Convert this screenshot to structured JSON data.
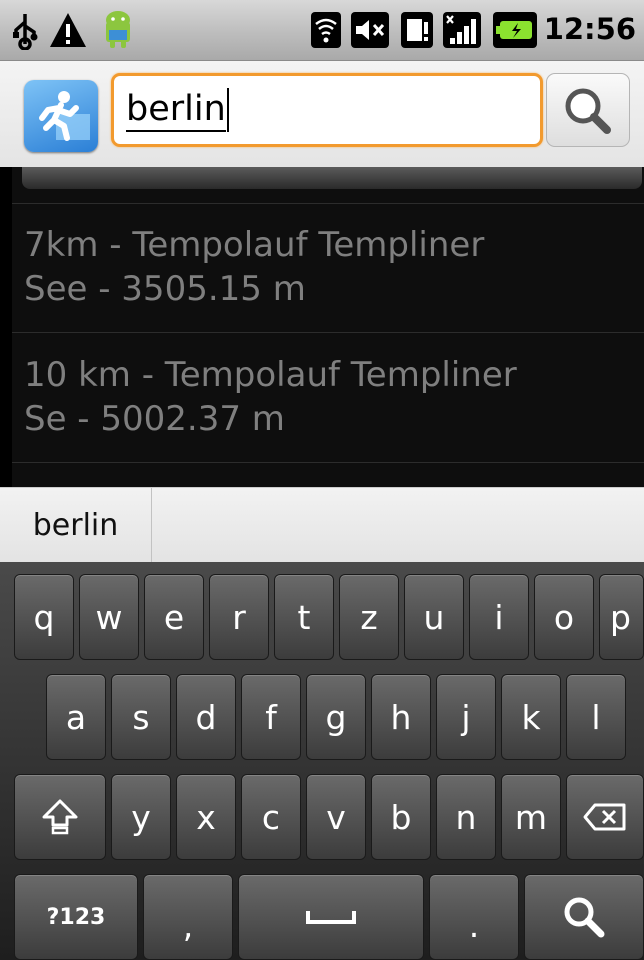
{
  "status_bar": {
    "time": "12:56",
    "icons": [
      "usb-icon",
      "warning-icon",
      "android-icon",
      "wifi-icon",
      "mute-icon",
      "sim-icon",
      "signal-icon",
      "battery-icon"
    ]
  },
  "search": {
    "query": "berlin"
  },
  "results": [
    {
      "line1": "7km - Tempolauf Templiner",
      "line2": "See - 3505.15 m"
    },
    {
      "line1": "10 km - Tempolauf Templiner",
      "line2": "Se - 5002.37 m"
    }
  ],
  "suggestions": [
    "berlin"
  ],
  "keyboard": {
    "row1": [
      "q",
      "w",
      "e",
      "r",
      "t",
      "z",
      "u",
      "i",
      "o",
      "p"
    ],
    "row2": [
      "a",
      "s",
      "d",
      "f",
      "g",
      "h",
      "j",
      "k",
      "l"
    ],
    "row3": [
      "y",
      "x",
      "c",
      "v",
      "b",
      "n",
      "m"
    ],
    "symbols_label": "?123",
    "comma": ",",
    "period": "."
  },
  "colors": {
    "focus_border": "#f29a2e",
    "result_text": "#7f7f7f"
  }
}
